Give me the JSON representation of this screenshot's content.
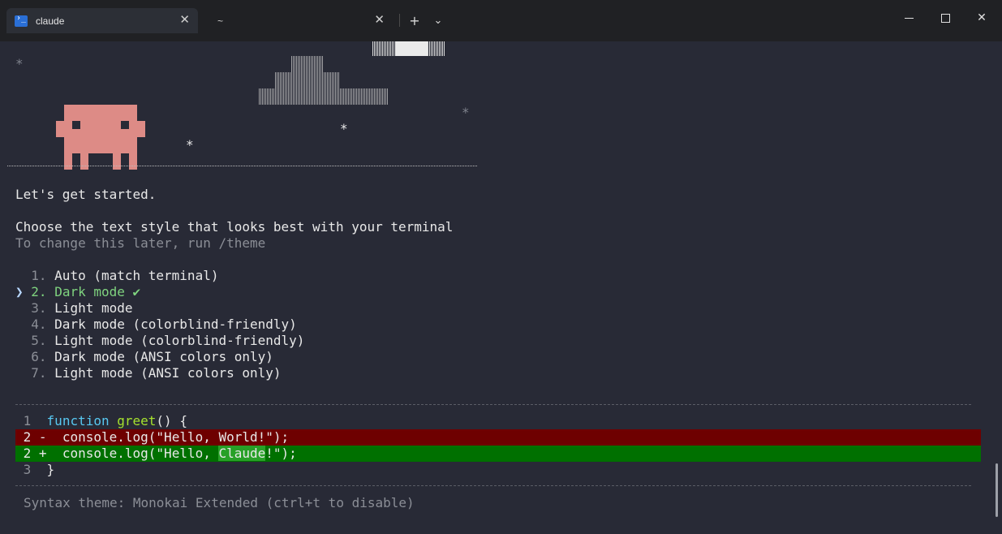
{
  "tabs": [
    {
      "label": "claude",
      "icon": "powershell-icon",
      "active": true
    },
    {
      "label": "~",
      "active": false
    }
  ],
  "tab_close": "✕",
  "new_tab": "+",
  "dropdown": "⌄",
  "window_close": "✕",
  "terminal": {
    "stars": [
      "*",
      "*",
      "*",
      "*",
      "*"
    ],
    "intro": "Let's get started.",
    "heading": "Choose the text style that looks best with your terminal",
    "subheading": "To change this later, run /theme",
    "selector": "❯",
    "options": [
      {
        "num": "1.",
        "label": "Auto (match terminal)"
      },
      {
        "num": "2.",
        "label": "Dark mode ✔"
      },
      {
        "num": "3.",
        "label": "Light mode"
      },
      {
        "num": "4.",
        "label": "Dark mode (colorblind-friendly)"
      },
      {
        "num": "5.",
        "label": "Light mode (colorblind-friendly)"
      },
      {
        "num": "6.",
        "label": "Dark mode (ANSI colors only)"
      },
      {
        "num": "7.",
        "label": "Light mode (ANSI colors only)"
      }
    ],
    "code": {
      "line1": {
        "num": "1",
        "keyword": "function",
        "fname": "greet",
        "rest": "() {"
      },
      "line2_del": {
        "num": "2",
        "sign": "-",
        "text": "console.log(\"Hello, World!\");"
      },
      "line2_add": {
        "num": "2",
        "sign": "+",
        "pre": "console.log(\"Hello, ",
        "highlight": "Claude",
        "post": "!\");"
      },
      "line3": {
        "num": "3",
        "text": "}"
      }
    },
    "footer": "Syntax theme: Monokai Extended (ctrl+t to disable)"
  },
  "colors": {
    "background": "#282a36",
    "mascot": "#dd8b86",
    "selected": "#7fd37f",
    "deleted": "#6e0000",
    "added": "#007000"
  }
}
